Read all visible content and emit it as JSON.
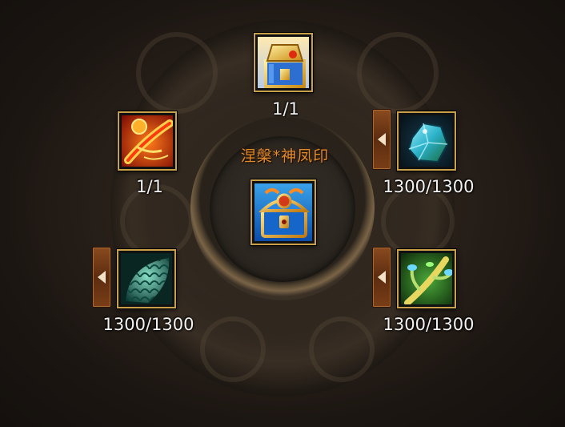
{
  "title": "涅槃*神凤印",
  "center_item": {
    "icon": "ornate-treasure-chest-icon"
  },
  "slots": [
    {
      "id": "top",
      "icon": "golden-treasure-box-icon",
      "count": "1/1",
      "has_tab": false
    },
    {
      "id": "left-upper",
      "icon": "fire-scroll-icon",
      "count": "1/1",
      "has_tab": false
    },
    {
      "id": "right-upper",
      "icon": "crystal-ore-icon",
      "count": "1300/1300",
      "has_tab": true
    },
    {
      "id": "left-lower",
      "icon": "dragon-scale-icon",
      "count": "1300/1300",
      "has_tab": true
    },
    {
      "id": "right-lower",
      "icon": "spirit-vine-icon",
      "count": "1300/1300",
      "has_tab": true
    }
  ],
  "colors": {
    "frame": "#c8a04a",
    "title": "#e08a2c",
    "tab": "#7a3e17"
  }
}
